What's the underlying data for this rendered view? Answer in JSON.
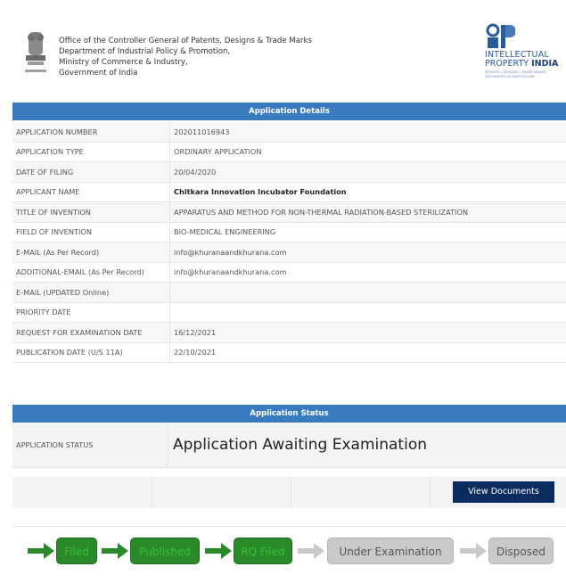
{
  "header": {
    "office_lines": [
      "Office of the Controller General of Patents, Designs & Trade Marks",
      "Department of Industrial Policy & Promotion,",
      "Ministry of Commerce & Industry,",
      "Government of India"
    ],
    "logo": {
      "line1": "INTELLECTUAL",
      "line2a": "PROPERTY ",
      "line2b": "INDIA",
      "line3": "PATENTS | DESIGNS | TRADE MARKS GEOGRAPHICAL INDICATIONS"
    }
  },
  "details": {
    "title": "Application Details",
    "rows": [
      {
        "label": "APPLICATION NUMBER",
        "value": "202011016943"
      },
      {
        "label": "APPLICATION TYPE",
        "value": "ORDINARY APPLICATION"
      },
      {
        "label": "DATE OF FILING",
        "value": "20/04/2020"
      },
      {
        "label": "APPLICANT NAME",
        "value": "Chitkara Innovation Incubator Foundation"
      },
      {
        "label": "TITLE OF INVENTION",
        "value": "APPARATUS AND METHOD FOR NON-THERMAL RADIATION-BASED STERILIZATION"
      },
      {
        "label": "FIELD OF INVENTION",
        "value": "BIO-MEDICAL ENGINEERING"
      },
      {
        "label": "E-MAIL (As Per Record)",
        "value": "info@khuranaandkhurana.com"
      },
      {
        "label": "ADDITIONAL-EMAIL (As Per Record)",
        "value": "info@khuranaandkhurana.com"
      },
      {
        "label": "E-MAIL (UPDATED Online)",
        "value": ""
      },
      {
        "label": "PRIORITY DATE",
        "value": ""
      },
      {
        "label": "REQUEST FOR EXAMINATION DATE",
        "value": "16/12/2021"
      },
      {
        "label": "PUBLICATION DATE (U/S 11A)",
        "value": "22/10/2021"
      }
    ]
  },
  "status": {
    "title": "Application Status",
    "label": "APPLICATION STATUS",
    "value": "Application Awaiting Examination"
  },
  "documents": {
    "button_label": "View Documents"
  },
  "workflow": {
    "stages": [
      {
        "label": "Filed",
        "state": "done"
      },
      {
        "label": "Published",
        "state": "done"
      },
      {
        "label": "RQ Filed",
        "state": "done"
      },
      {
        "label": "Under Examination",
        "state": "pending"
      },
      {
        "label": "Disposed",
        "state": "pending"
      }
    ]
  },
  "colors": {
    "header_bar": "#3a7bbf",
    "button": "#0b2c5f",
    "stage_done": "#2a8a2a",
    "stage_pending": "#c9c9c9"
  }
}
